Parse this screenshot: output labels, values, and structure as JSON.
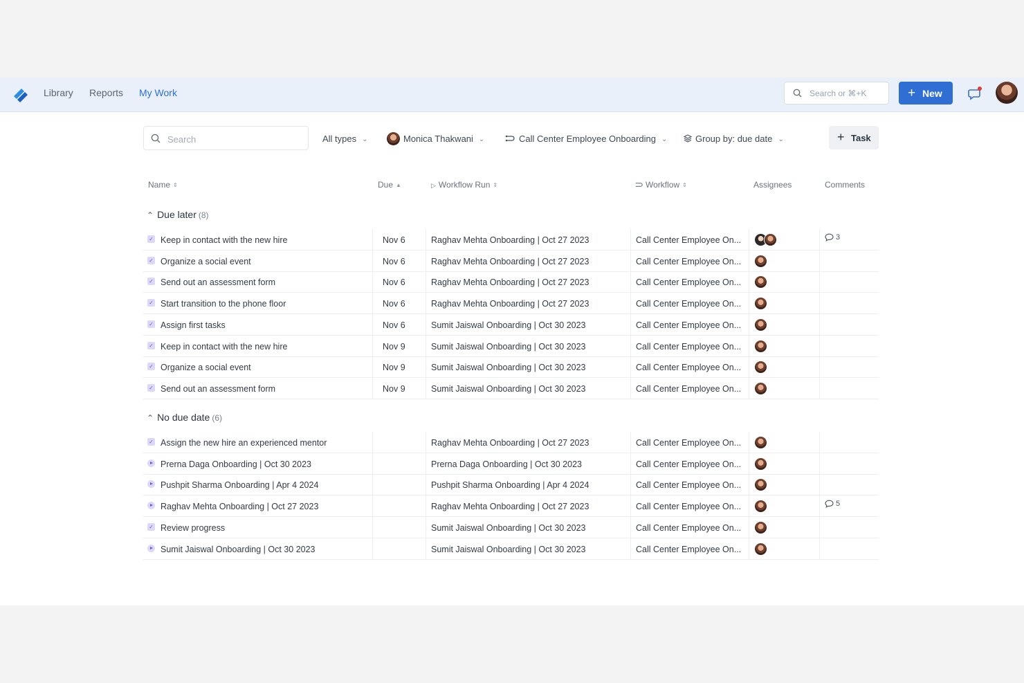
{
  "nav": {
    "items": [
      {
        "label": "Library",
        "active": false
      },
      {
        "label": "Reports",
        "active": false
      },
      {
        "label": "My Work",
        "active": true
      }
    ],
    "search_placeholder": "Search or ⌘+K",
    "new_label": "New",
    "brand_color": "#2f6fd3"
  },
  "toolbar": {
    "search_placeholder": "Search",
    "type_filter": "All types",
    "assignee_filter": "Monica Thakwani",
    "workflow_filter": "Call Center Employee Onboarding",
    "group_filter": "Group by: due date",
    "task_label": "Task"
  },
  "columns": [
    "Name",
    "Due",
    "Workflow Run",
    "Workflow",
    "Assignees",
    "Comments"
  ],
  "groups": [
    {
      "label": "Due later",
      "count": "(8)",
      "rows": [
        {
          "icon": "check",
          "name": "Keep in contact with the new hire",
          "due": "Nov 6",
          "run": "Raghav Mehta Onboarding | Oct 27 2023",
          "workflow": "Call Center Employee On...",
          "assignees": 2,
          "comments": "3"
        },
        {
          "icon": "check",
          "name": "Organize a social event",
          "due": "Nov 6",
          "run": "Raghav Mehta Onboarding | Oct 27 2023",
          "workflow": "Call Center Employee On...",
          "assignees": 1,
          "comments": ""
        },
        {
          "icon": "check",
          "name": "Send out an assessment form",
          "due": "Nov 6",
          "run": "Raghav Mehta Onboarding | Oct 27 2023",
          "workflow": "Call Center Employee On...",
          "assignees": 1,
          "comments": ""
        },
        {
          "icon": "check",
          "name": "Start transition to the phone floor",
          "due": "Nov 6",
          "run": "Raghav Mehta Onboarding | Oct 27 2023",
          "workflow": "Call Center Employee On...",
          "assignees": 1,
          "comments": ""
        },
        {
          "icon": "check",
          "name": "Assign first tasks",
          "due": "Nov 6",
          "run": "Sumit Jaiswal Onboarding | Oct 30 2023",
          "workflow": "Call Center Employee On...",
          "assignees": 1,
          "comments": ""
        },
        {
          "icon": "check",
          "name": "Keep in contact with the new hire",
          "due": "Nov 9",
          "run": "Sumit Jaiswal Onboarding | Oct 30 2023",
          "workflow": "Call Center Employee On...",
          "assignees": 1,
          "comments": ""
        },
        {
          "icon": "check",
          "name": "Organize a social event",
          "due": "Nov 9",
          "run": "Sumit Jaiswal Onboarding | Oct 30 2023",
          "workflow": "Call Center Employee On...",
          "assignees": 1,
          "comments": ""
        },
        {
          "icon": "check",
          "name": "Send out an assessment form",
          "due": "Nov 9",
          "run": "Sumit Jaiswal Onboarding | Oct 30 2023",
          "workflow": "Call Center Employee On...",
          "assignees": 1,
          "comments": ""
        }
      ]
    },
    {
      "label": "No due date",
      "count": "(6)",
      "rows": [
        {
          "icon": "check",
          "name": "Assign the new hire an experienced mentor",
          "due": "",
          "run": "Raghav Mehta Onboarding | Oct 27 2023",
          "workflow": "Call Center Employee On...",
          "assignees": 1,
          "comments": ""
        },
        {
          "icon": "play",
          "name": "Prerna Daga Onboarding | Oct 30 2023",
          "due": "",
          "run": "Prerna Daga Onboarding | Oct 30 2023",
          "workflow": "Call Center Employee On...",
          "assignees": 1,
          "comments": ""
        },
        {
          "icon": "play",
          "name": "Pushpit Sharma Onboarding | Apr 4 2024",
          "due": "",
          "run": "Pushpit Sharma Onboarding | Apr 4 2024",
          "workflow": "Call Center Employee On...",
          "assignees": 1,
          "comments": ""
        },
        {
          "icon": "play",
          "name": "Raghav Mehta Onboarding | Oct 27 2023",
          "due": "",
          "run": "Raghav Mehta Onboarding | Oct 27 2023",
          "workflow": "Call Center Employee On...",
          "assignees": 1,
          "comments": "5"
        },
        {
          "icon": "check",
          "name": "Review progress",
          "due": "",
          "run": "Sumit Jaiswal Onboarding | Oct 30 2023",
          "workflow": "Call Center Employee On...",
          "assignees": 1,
          "comments": ""
        },
        {
          "icon": "play",
          "name": "Sumit Jaiswal Onboarding | Oct 30 2023",
          "due": "",
          "run": "Sumit Jaiswal Onboarding | Oct 30 2023",
          "workflow": "Call Center Employee On...",
          "assignees": 1,
          "comments": ""
        }
      ]
    }
  ]
}
